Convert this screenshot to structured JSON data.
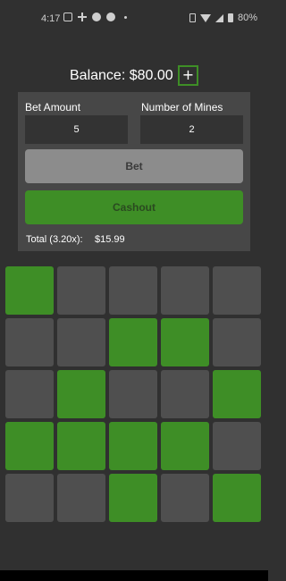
{
  "status_bar": {
    "time": "4:17",
    "left_icons": [
      "message-icon",
      "slack-icon",
      "messenger-icon",
      "messenger-icon"
    ],
    "right_icons": [
      "vibrate-icon",
      "wifi-icon",
      "signal-icon",
      "battery-icon"
    ],
    "battery": "80%"
  },
  "balance": {
    "text": "Balance: $80.00",
    "add_label": "+"
  },
  "form": {
    "bet_amount_label": "Bet Amount",
    "bet_amount_value": "5",
    "mines_label": "Number of Mines",
    "mines_value": "2",
    "bet_button": "Bet",
    "cashout_button": "Cashout",
    "total_label": "Total (3.20x):",
    "total_value": "$15.99"
  },
  "grid": {
    "rows": 5,
    "cols": 5,
    "tiles": [
      [
        1,
        0,
        0,
        0,
        0
      ],
      [
        0,
        0,
        1,
        1,
        0
      ],
      [
        0,
        1,
        0,
        0,
        1
      ],
      [
        1,
        1,
        1,
        1,
        0
      ],
      [
        0,
        0,
        1,
        0,
        1
      ]
    ]
  },
  "colors": {
    "background": "#303030",
    "panel": "#474747",
    "accent_green": "#3e8e26",
    "tile_hidden": "#4f4f4f",
    "bet_button": "#8c8c8c"
  }
}
